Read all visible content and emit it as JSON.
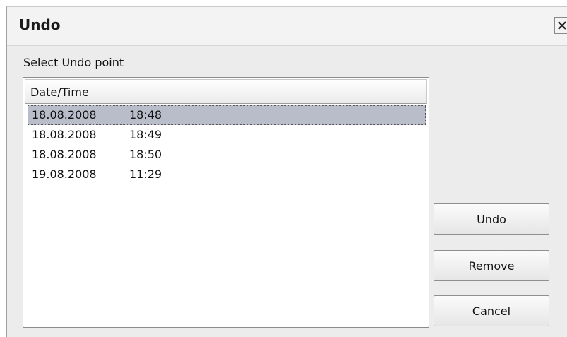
{
  "dialog": {
    "title": "Undo",
    "close_icon": "close-icon",
    "subtitle": "Select Undo point"
  },
  "list": {
    "column_header": "Date/Time",
    "selected_index": 0,
    "rows": [
      {
        "date": "18.08.2008",
        "time": "18:48"
      },
      {
        "date": "18.08.2008",
        "time": "18:49"
      },
      {
        "date": "18.08.2008",
        "time": "18:50"
      },
      {
        "date": "19.08.2008",
        "time": "11:29"
      }
    ]
  },
  "buttons": {
    "undo": "Undo",
    "remove": "Remove",
    "cancel": "Cancel"
  },
  "colors": {
    "selection": "#b9bcc9",
    "dialog_bg": "#ececec"
  }
}
